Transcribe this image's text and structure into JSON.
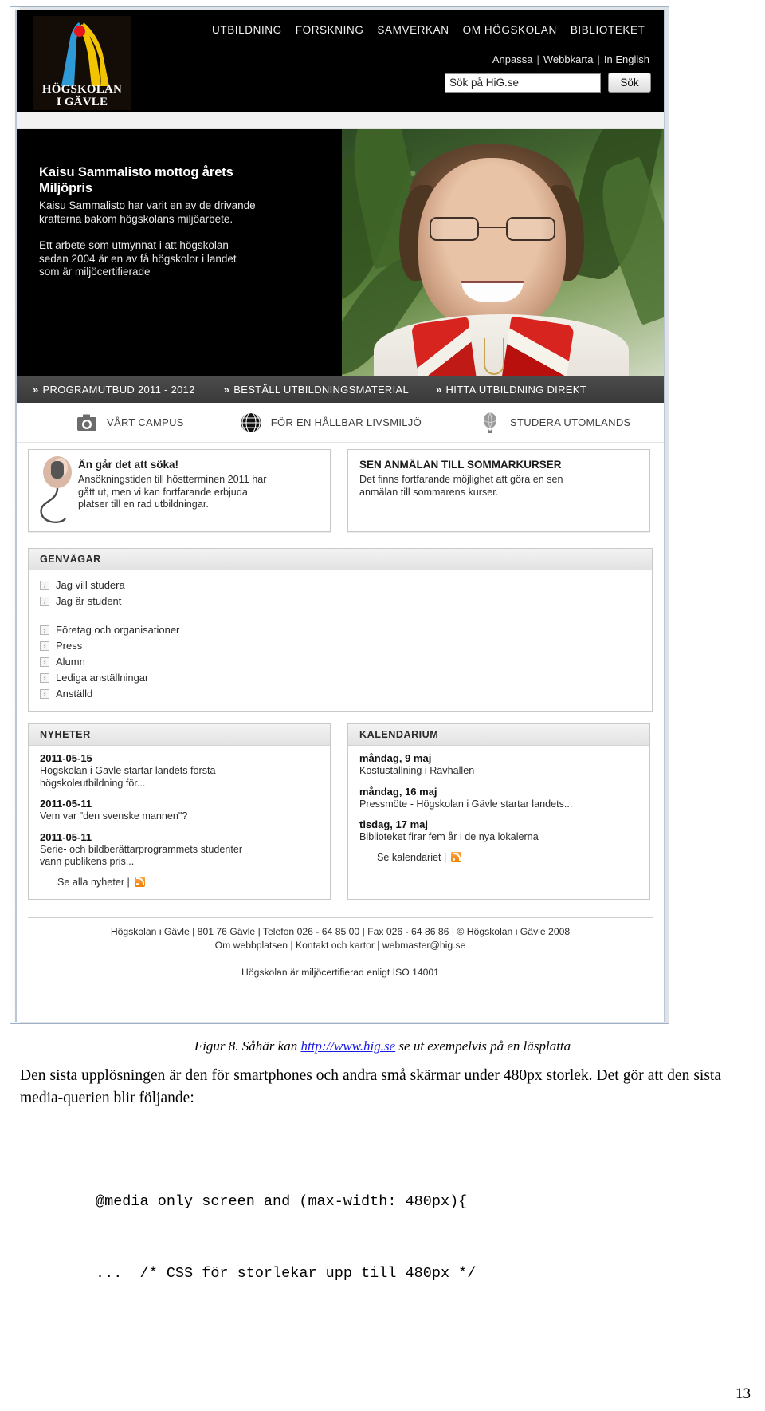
{
  "site": {
    "logo": {
      "line1": "HÖGSKOLAN",
      "line2": "I GÄVLE",
      "name": "hig-logo"
    },
    "mainnav": [
      {
        "label": "UTBILDNING"
      },
      {
        "label": "FORSKNING"
      },
      {
        "label": "SAMVERKAN"
      },
      {
        "label": "OM HÖGSKOLAN"
      },
      {
        "label": "BIBLIOTEKET"
      }
    ],
    "utilnav": [
      {
        "label": "Anpassa"
      },
      {
        "label": "Webbkarta"
      },
      {
        "label": "In English"
      }
    ],
    "search": {
      "value": "Sök på HiG.se",
      "placeholder": "Sök på HiG.se",
      "button": "Sök"
    },
    "hero": {
      "title_line1": "Kaisu Sammalisto mottog årets",
      "title_line2": "Miljöpris",
      "sub_line1": "Kaisu Sammalisto har varit en av de drivande",
      "sub_line2": "krafterna bakom högskolans miljöarbete.",
      "p2_line1": "Ett arbete som utmynnat i att högskolan",
      "p2_line2": "sedan 2004 är en av få högskolor i landet",
      "p2_line3": "som är miljöcertifierade"
    },
    "quickbar": [
      {
        "label": "PROGRAMUTBUD 2011 - 2012",
        "chevron": "»"
      },
      {
        "label": "BESTÄLL UTBILDNINGSMATERIAL",
        "chevron": "»"
      },
      {
        "label": "HITTA UTBILDNING DIREKT",
        "chevron": "»"
      }
    ],
    "iconrow": [
      {
        "label": "VÅRT CAMPUS",
        "icon": "camera-icon"
      },
      {
        "label": "FÖR EN HÅLLBAR LIVSMILJÖ",
        "icon": "globe-icon"
      },
      {
        "label": "STUDERA UTOMLANDS",
        "icon": "hot-air-balloon-icon"
      }
    ],
    "promos": [
      {
        "heading": "Än går det att söka!",
        "body_line1": "Ansökningstiden till höstterminen 2011 har",
        "body_line2": "gått ut, men vi kan fortfarande erbjuda",
        "body_line3": "platser till en rad utbildningar.",
        "icon": "computer-mouse-icon"
      },
      {
        "heading": "SEN ANMÄLAN TILL SOMMARKURSER",
        "body_line1": "Det finns fortfarande möjlighet att göra en sen",
        "body_line2": "anmälan till sommarens kurser.",
        "body_line3": ""
      }
    ],
    "genvagar": {
      "heading": "GENVÄGAR",
      "group1": [
        {
          "label": "Jag vill studera"
        },
        {
          "label": "Jag är student"
        }
      ],
      "group2": [
        {
          "label": "Företag och organisationer"
        },
        {
          "label": "Press"
        },
        {
          "label": "Alumn"
        },
        {
          "label": "Lediga anställningar"
        },
        {
          "label": "Anställd"
        }
      ]
    },
    "news": {
      "heading": "NYHETER",
      "items": [
        {
          "date": "2011-05-15",
          "text_line1": "Högskolan i Gävle startar landets första",
          "text_line2": "högskoleutbildning för..."
        },
        {
          "date": "2011-05-11",
          "text_line1": "Vem var \"den svenske mannen\"?",
          "text_line2": ""
        },
        {
          "date": "2011-05-11",
          "text_line1": "Serie- och bildberättarprogrammets studenter",
          "text_line2": "vann publikens pris..."
        }
      ],
      "more_label": "Se alla nyheter |",
      "rss_icon": "rss-icon"
    },
    "calendar": {
      "heading": "KALENDARIUM",
      "items": [
        {
          "date": "måndag, 9 maj",
          "text": "Kostuställning i Rävhallen"
        },
        {
          "date": "måndag, 16 maj",
          "text": "Pressmöte - Högskolan i Gävle startar landets..."
        },
        {
          "date": "tisdag, 17 maj",
          "text": "Biblioteket firar fem år i de nya lokalerna"
        }
      ],
      "more_label": "Se kalendariet |",
      "rss_icon": "rss-icon"
    },
    "footer": {
      "line1": "Högskolan i Gävle | 801 76 Gävle | Telefon 026 - 64 85 00 | Fax 026 - 64 86 86 | © Högskolan i Gävle 2008",
      "line2": "Om webbplatsen | Kontakt och kartor | webmaster@hig.se",
      "line3": "Högskolan är miljöcertifierad enligt ISO 14001"
    }
  },
  "document": {
    "figure_caption_pre": "Figur 8. Såhär kan ",
    "figure_caption_link": "http://www.hig.se",
    "figure_caption_post": " se ut exempelvis på en läsplatta",
    "paragraph": "Den sista upplösningen är den för smartphones och andra små skärmar under 480px storlek.  Det gör att den sista media-querien blir följande:",
    "code_line1": "@media only screen and (max-width: 480px){",
    "code_line2": "...  /* CSS för storlekar upp till 480px */",
    "page_number": "13"
  }
}
